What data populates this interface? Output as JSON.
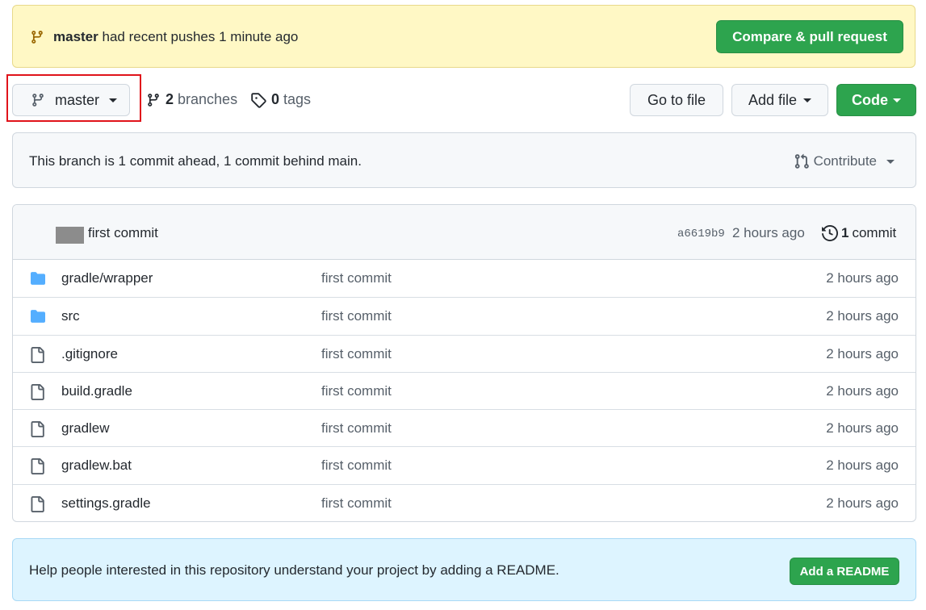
{
  "push_banner": {
    "branch": "master",
    "text": "had recent pushes 1 minute ago",
    "button": "Compare & pull request"
  },
  "toolbar": {
    "branch_button": "master",
    "branches_count": "2",
    "branches_label": "branches",
    "tags_count": "0",
    "tags_label": "tags",
    "goto_file": "Go to file",
    "add_file": "Add file",
    "code": "Code"
  },
  "branch_status": {
    "message": "This branch is 1 commit ahead, 1 commit behind main.",
    "contribute": "Contribute"
  },
  "latest_commit": {
    "message": "first commit",
    "sha": "a6619b9",
    "time": "2 hours ago",
    "count": "1",
    "count_label": "commit"
  },
  "files": [
    {
      "name": "gradle/wrapper",
      "type": "folder",
      "message": "first commit",
      "time": "2 hours ago"
    },
    {
      "name": "src",
      "type": "folder",
      "message": "first commit",
      "time": "2 hours ago"
    },
    {
      "name": ".gitignore",
      "type": "file",
      "message": "first commit",
      "time": "2 hours ago"
    },
    {
      "name": "build.gradle",
      "type": "file",
      "message": "first commit",
      "time": "2 hours ago"
    },
    {
      "name": "gradlew",
      "type": "file",
      "message": "first commit",
      "time": "2 hours ago"
    },
    {
      "name": "gradlew.bat",
      "type": "file",
      "message": "first commit",
      "time": "2 hours ago"
    },
    {
      "name": "settings.gradle",
      "type": "file",
      "message": "first commit",
      "time": "2 hours ago"
    }
  ],
  "readme_banner": {
    "message": "Help people interested in this repository understand your project by adding a README.",
    "button": "Add a README"
  },
  "colors": {
    "primary_green": "#2da44e",
    "banner_yellow": "#fff8c5",
    "banner_blue": "#ddf4ff",
    "folder_blue": "#54aeff",
    "highlight_red": "#e0131b"
  },
  "icons": {
    "branch": "git-branch-icon",
    "tag": "tag-icon",
    "pull_request": "git-pull-request-icon",
    "history": "history-icon",
    "folder": "folder-icon",
    "file": "file-icon"
  }
}
